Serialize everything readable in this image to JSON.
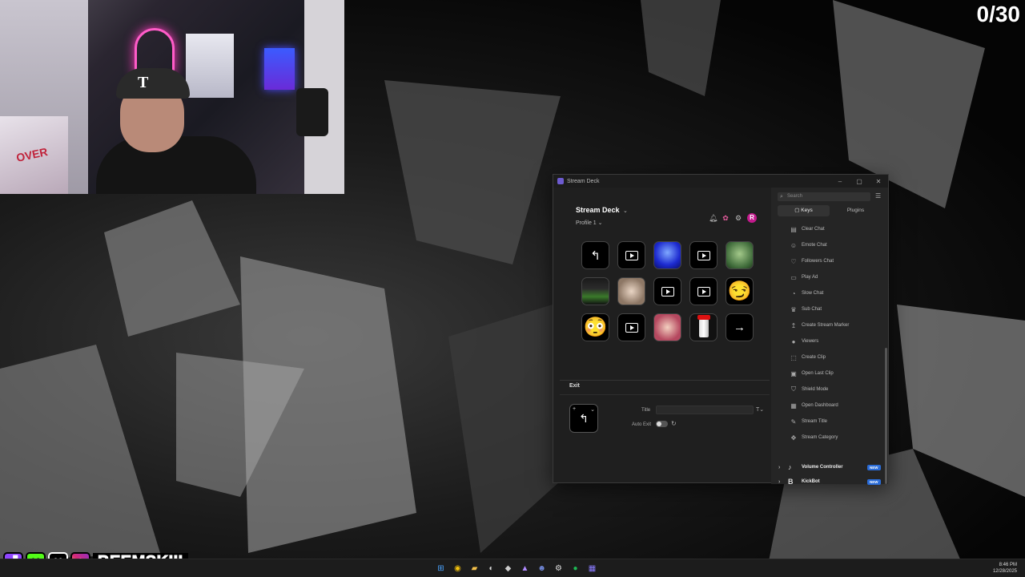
{
  "overlay": {
    "counter": "0/30",
    "social_handle": "BEEMSKIII"
  },
  "window": {
    "title": "Stream Deck",
    "controls": [
      "–",
      "▢",
      "✕"
    ]
  },
  "deck": {
    "name": "Stream Deck",
    "profile": "Profile 1"
  },
  "header_icons": [
    "bell-icon",
    "apps-icon",
    "gear-icon"
  ],
  "avatar_letter": "R",
  "keys": [
    {
      "type": "back",
      "glyph": "↰"
    },
    {
      "type": "play"
    },
    {
      "type": "blue-image"
    },
    {
      "type": "play"
    },
    {
      "type": "green-image"
    },
    {
      "type": "game-image"
    },
    {
      "type": "face-image"
    },
    {
      "type": "play"
    },
    {
      "type": "play"
    },
    {
      "type": "emoji",
      "glyph": "😏"
    },
    {
      "type": "emoji",
      "glyph": "😳"
    },
    {
      "type": "play"
    },
    {
      "type": "pink-image"
    },
    {
      "type": "can-image"
    },
    {
      "type": "arrow",
      "glyph": "→"
    }
  ],
  "editor": {
    "section_label": "Exit",
    "preview_glyph": "↰",
    "title_label": "Title",
    "title_value": "",
    "title_font_icon": "T",
    "auto_exit_label": "Auto Exit",
    "auto_exit_on": false
  },
  "right_panel": {
    "search_placeholder": "Search",
    "tabs": [
      {
        "label": "Keys",
        "active": true
      },
      {
        "label": "Plugins",
        "active": false
      }
    ],
    "actions": [
      {
        "label": "Clear Chat",
        "icon": "▤"
      },
      {
        "label": "Emote Chat",
        "icon": "☺"
      },
      {
        "label": "Followers Chat",
        "icon": "♡"
      },
      {
        "label": "Play Ad",
        "icon": "▭"
      },
      {
        "label": "Slow Chat",
        "icon": "◔"
      },
      {
        "label": "Sub Chat",
        "icon": "♛"
      },
      {
        "label": "Create Stream Marker",
        "icon": "↥"
      },
      {
        "label": "Viewers",
        "icon": "●"
      },
      {
        "label": "Create Clip",
        "icon": "⬚"
      },
      {
        "label": "Open Last Clip",
        "icon": "▣"
      },
      {
        "label": "Shield Mode",
        "icon": "⛉"
      },
      {
        "label": "Open Dashboard",
        "icon": "▦"
      },
      {
        "label": "Stream Title",
        "icon": "✎"
      },
      {
        "label": "Stream Category",
        "icon": "✥"
      }
    ],
    "plugins": [
      {
        "label": "Volume Controller",
        "icon": "♪",
        "badge": "NEW"
      },
      {
        "label": "KickBot",
        "icon": "B",
        "badge": "NEW"
      }
    ]
  },
  "taskbar": {
    "time": "8:46 PM",
    "date": "12/28/2025"
  },
  "colors": {
    "accent": "#2a6cd8",
    "avatar": "#c21a8c",
    "twitch": "#9146ff",
    "kick": "#53fc18"
  }
}
